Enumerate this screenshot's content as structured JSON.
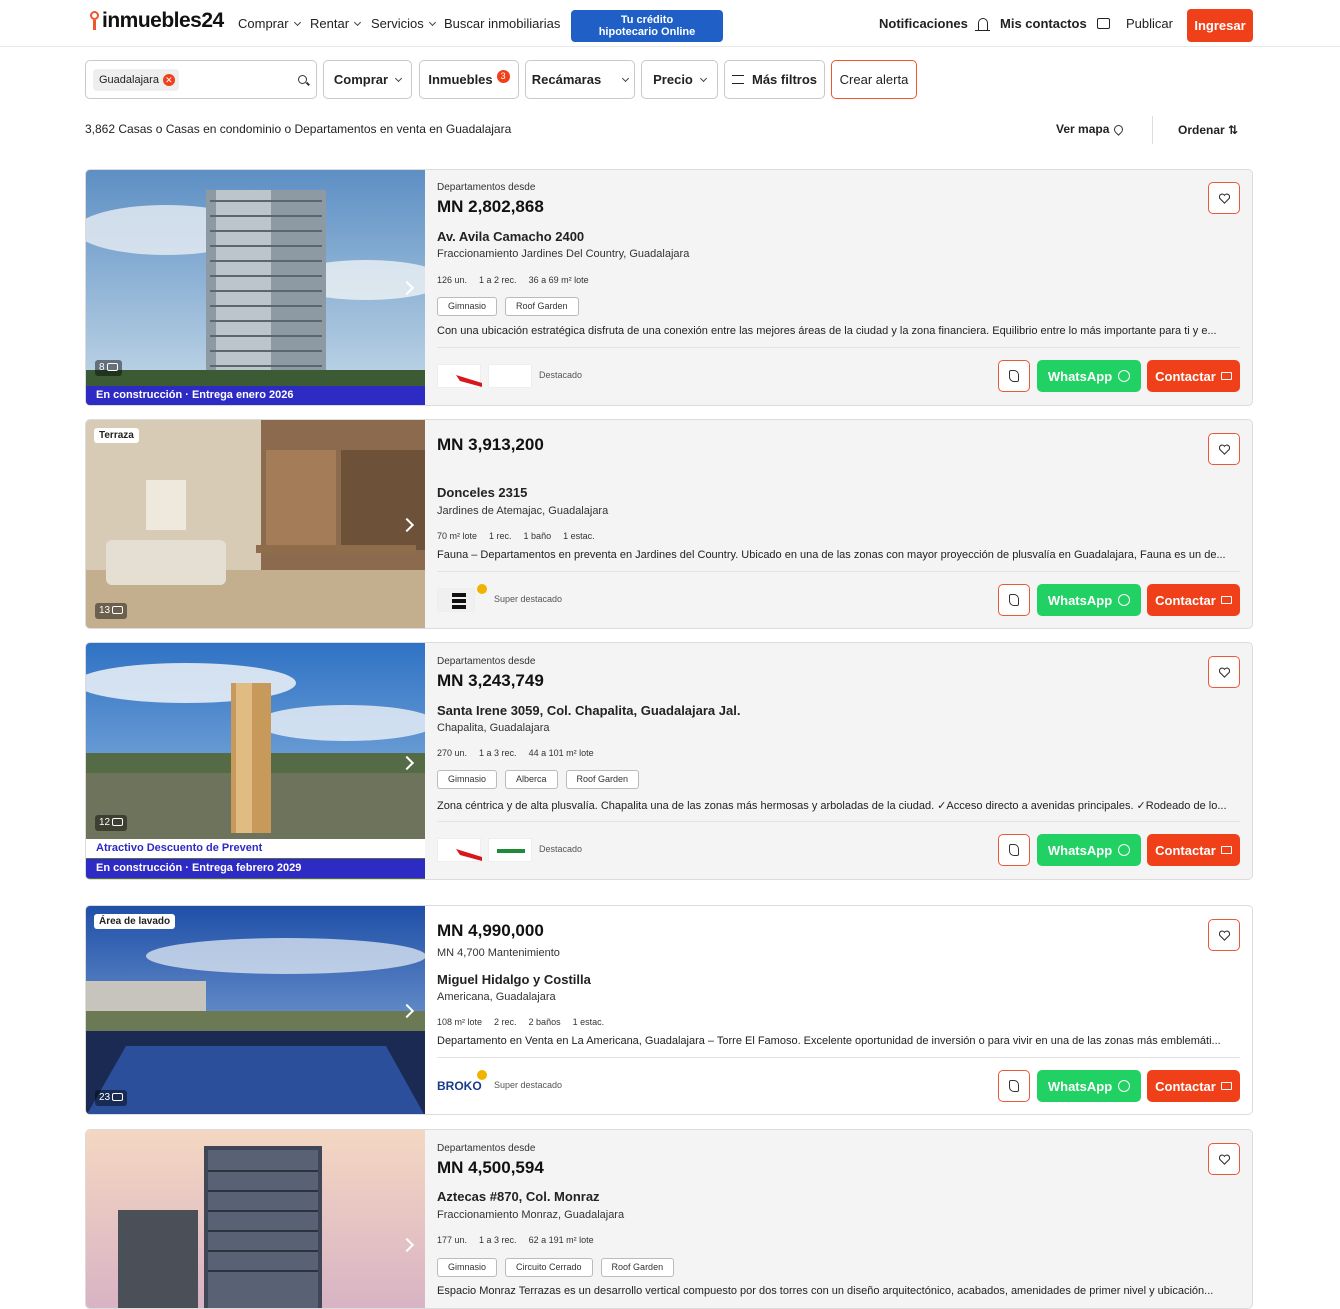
{
  "header": {
    "logo": "inmuebles24",
    "nav": [
      "Comprar",
      "Rentar",
      "Servicios"
    ],
    "buscar": "Buscar inmobiliarias",
    "credit_line1": "Tu crédito",
    "credit_line2": "hipotecario Online",
    "notificaciones": "Notificaciones",
    "contactos": "Mis contactos",
    "publicar": "Publicar",
    "ingresar": "Ingresar"
  },
  "filters": {
    "chip": "Guadalajara",
    "comprar": "Comprar",
    "inmuebles": "Inmuebles",
    "inmuebles_count": "3",
    "recamaras": "Recámaras",
    "precio": "Precio",
    "mas_filtros": "Más filtros",
    "crear_alerta": "Crear alerta"
  },
  "results": {
    "summary": "3,862 Casas o Casas en condominio o Departamentos en venta en Guadalajara",
    "ver_mapa": "Ver mapa",
    "ordenar": "Ordenar"
  },
  "buttons": {
    "whatsapp": "WhatsApp",
    "contactar": "Contactar"
  },
  "listings": [
    {
      "from_label": "Departamentos desde",
      "price": "MN 2,802,868",
      "address": "Av. Avila Camacho 2400",
      "location": "Fraccionamiento Jardines Del Country, Guadalajara",
      "features": [
        "126 un.",
        "1 a 2 rec.",
        "36 a 69 m² lote"
      ],
      "amenities": [
        "Gimnasio",
        "Roof Garden"
      ],
      "description": "Con una ubicación estratégica disfruta de una conexión entre las mejores áreas de la ciudad y la zona financiera. Equilibrio entre lo más importante para ti y e...",
      "level": "Destacado",
      "photos": "8",
      "strip": "En construcción · Entrega enero 2026"
    },
    {
      "price": "MN 3,913,200",
      "address": "Donceles 2315",
      "location": "Jardines de Atemajac, Guadalajara",
      "features": [
        "70 m² lote",
        "1 rec.",
        "1 baño",
        "1 estac."
      ],
      "description": "Fauna – Departamentos en preventa en Jardines del Country. Ubicado en una de las zonas con mayor proyección de plusvalía en Guadalajara, Fauna es un de...",
      "level": "Super destacado",
      "photos": "13",
      "tag": "Terraza"
    },
    {
      "from_label": "Departamentos desde",
      "price": "MN 3,243,749",
      "address": "Santa Irene 3059, Col. Chapalita, Guadalajara Jal.",
      "location": "Chapalita, Guadalajara",
      "features": [
        "270 un.",
        "1 a 3 rec.",
        "44 a 101 m² lote"
      ],
      "amenities": [
        "Gimnasio",
        "Alberca",
        "Roof Garden"
      ],
      "description": "Zona céntrica y de alta plusvalía. Chapalita una de las zonas más hermosas y arboladas de la ciudad. ✓Acceso directo a avenidas principales. ✓Rodeado de lo...",
      "level": "Destacado",
      "photos": "12",
      "strip_top": "Atractivo Descuento de Prevent",
      "strip": "En construcción · Entrega febrero 2029"
    },
    {
      "price": "MN 4,990,000",
      "maintenance": "MN 4,700 Mantenimiento",
      "address": "Miguel Hidalgo y Costilla",
      "location": "Americana, Guadalajara",
      "features": [
        "108 m² lote",
        "2 rec.",
        "2 baños",
        "1 estac."
      ],
      "description": "Departamento en Venta en La Americana, Guadalajara – Torre El Famoso. Excelente oportunidad de inversión o para vivir en una de las zonas más emblemáti...",
      "level": "Super destacado",
      "photos": "23",
      "tag": "Área de lavado",
      "agency": "BROKO"
    },
    {
      "from_label": "Departamentos desde",
      "price": "MN 4,500,594",
      "address": "Aztecas #870, Col. Monraz",
      "location": "Fraccionamiento Monraz, Guadalajara",
      "features": [
        "177 un.",
        "1 a 3 rec.",
        "62 a 191 m² lote"
      ],
      "amenities": [
        "Gimnasio",
        "Circuito Cerrado",
        "Roof Garden"
      ],
      "description": "Espacio Monraz Terrazas es un desarrollo vertical compuesto por dos torres con un diseño arquitectónico, acabados, amenidades de primer nivel y ubicación..."
    }
  ]
}
